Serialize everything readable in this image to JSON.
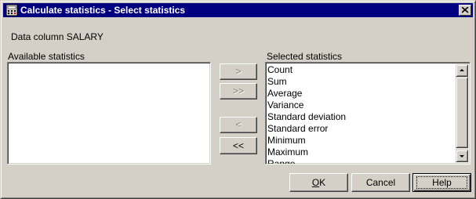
{
  "window": {
    "title": "Calculate statistics - Select statistics",
    "title_icon": "calculator-icon",
    "close_label": "close-icon"
  },
  "data_column": {
    "label": "Data column",
    "value": "SALARY"
  },
  "available": {
    "label": "Available statistics",
    "items": []
  },
  "selected": {
    "label": "Selected statistics",
    "items": [
      "Count",
      "Sum",
      "Average",
      "Variance",
      "Standard deviation",
      "Standard error",
      "Minimum",
      "Maximum",
      "Range"
    ]
  },
  "transfer_buttons": {
    "add": ">",
    "add_all": ">>",
    "remove": "<",
    "remove_all": "<<"
  },
  "footer": {
    "ok": "OK",
    "ok_mnemonic": "O",
    "cancel": "Cancel",
    "help": "Help"
  },
  "colors": {
    "titlebar": "#000080",
    "face": "#d4d0c8"
  }
}
